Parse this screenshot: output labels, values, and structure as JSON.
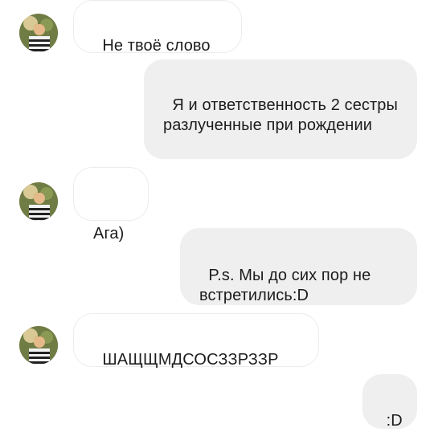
{
  "messages": [
    {
      "direction": "incoming",
      "text": "Не твоё слово"
    },
    {
      "direction": "outgoing",
      "text": "Я и ответственность 2 сестры разлученные при рождении"
    },
    {
      "direction": "incoming",
      "text": "Ага)"
    },
    {
      "direction": "outgoing",
      "text": "P.s. Мы до сих пор не встретились:D"
    },
    {
      "direction": "incoming",
      "text": "ШАЩЩМДСОСЗЗРЗЗР"
    },
    {
      "direction": "outgoing",
      "text": ":D"
    }
  ],
  "colors": {
    "incoming_bubble_bg": "#ffffff",
    "incoming_bubble_border": "#ececec",
    "outgoing_bubble_bg": "#efefef",
    "text": "#1c1c1c"
  },
  "icons": {
    "avatar": "sender-avatar"
  }
}
